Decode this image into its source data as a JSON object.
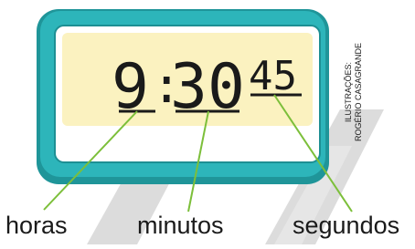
{
  "clock": {
    "hours": "9",
    "minutes": "30",
    "seconds": "45",
    "button_count": 4
  },
  "labels": {
    "hours": "horas",
    "minutes": "minutos",
    "seconds": "segundos"
  },
  "credit": {
    "line1": "ILUSTRAÇÕES:",
    "line2": "ROGÉRIO CASAGRANDE"
  },
  "colors": {
    "body_teal": "#2bb3b8",
    "body_dark": "#1d8f93",
    "screen": "#fbf2c0",
    "digits": "#1a1a1a",
    "pointer_lines": "#7cbf3a",
    "buttons": "#ffffff",
    "watermark": "#d9d9d9"
  }
}
